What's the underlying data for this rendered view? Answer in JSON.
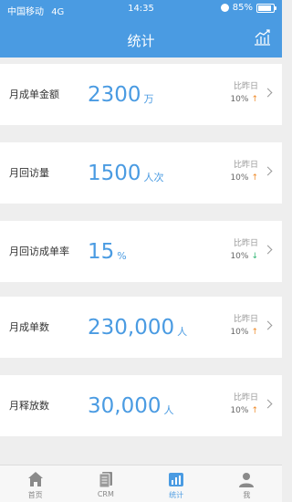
{
  "status_bar": {
    "carrier": "中国移动",
    "network": "4G",
    "time": "14:35",
    "battery": "85%",
    "battery_level": 0.85
  },
  "nav": {
    "title": "统计",
    "action_icon": "chart-icon"
  },
  "compare_label": "比昨日",
  "cards": [
    {
      "label": "月成单金额",
      "value": "2300",
      "unit": "万",
      "change": "10%",
      "direction": "up"
    },
    {
      "label": "月回访量",
      "value": "1500",
      "unit": "人次",
      "change": "10%",
      "direction": "up"
    },
    {
      "label": "月回访成单率",
      "value": "15",
      "unit": "%",
      "change": "10%",
      "direction": "down"
    },
    {
      "label": "月成单数",
      "value": "230,000",
      "unit": "人",
      "change": "10%",
      "direction": "up"
    },
    {
      "label": "月释放数",
      "value": "30,000",
      "unit": "人",
      "change": "10%",
      "direction": "up"
    }
  ],
  "arrows": {
    "up": "↑",
    "down": "↓"
  },
  "tabbar": [
    {
      "label": "首页",
      "icon": "home-icon",
      "active": false
    },
    {
      "label": "CRM",
      "icon": "crm-icon",
      "active": false
    },
    {
      "label": "统计",
      "icon": "stats-icon",
      "active": true
    },
    {
      "label": "我",
      "icon": "user-icon",
      "active": false
    }
  ],
  "colors": {
    "primary": "#4a9be2",
    "up": "#ef8b2c",
    "down": "#31b574",
    "background": "#eeeeee"
  }
}
